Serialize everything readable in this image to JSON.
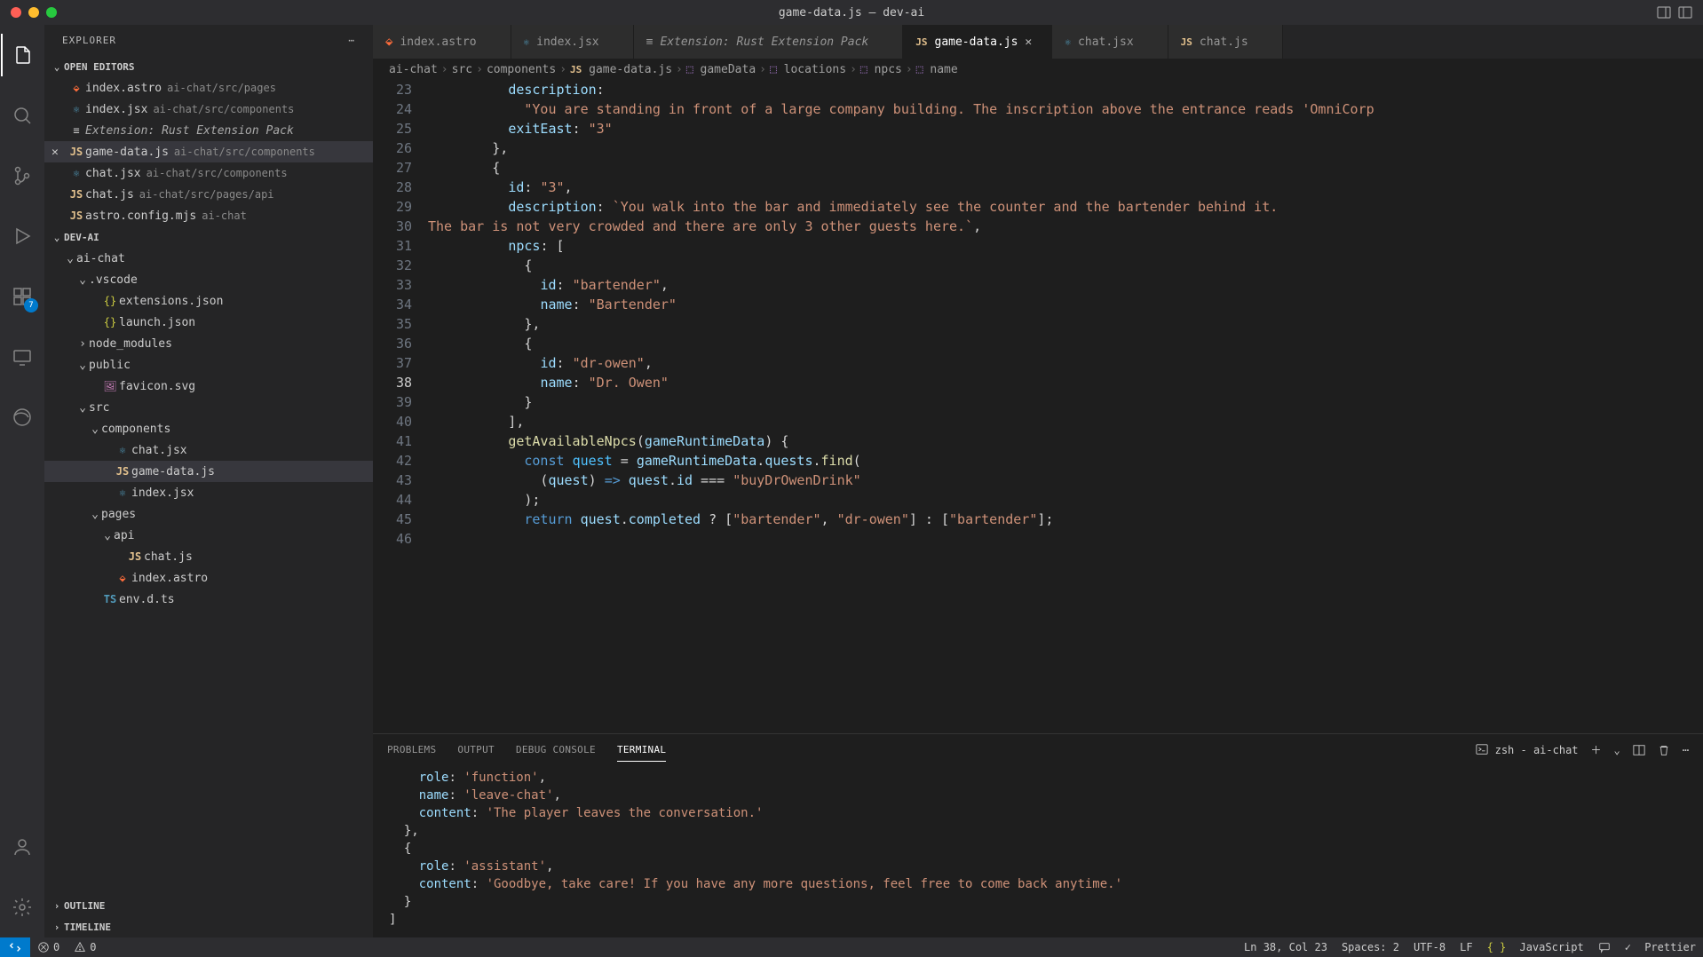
{
  "window": {
    "title": "game-data.js — dev-ai"
  },
  "sidebar": {
    "title": "EXPLORER",
    "openEditorsLabel": "OPEN EDITORS",
    "projectLabel": "DEV-AI",
    "outlineLabel": "OUTLINE",
    "timelineLabel": "TIMELINE",
    "openEditors": [
      {
        "name": "index.astro",
        "detail": "ai-chat/src/pages",
        "iconClass": "file-astro",
        "iconText": "⬙"
      },
      {
        "name": "index.jsx",
        "detail": "ai-chat/src/components",
        "iconClass": "file-jsx",
        "iconText": "⚛"
      },
      {
        "name": "Extension: Rust Extension Pack",
        "detail": "",
        "italic": true,
        "iconClass": "",
        "iconText": "≡"
      },
      {
        "name": "game-data.js",
        "detail": "ai-chat/src/components",
        "active": true,
        "iconClass": "file-js",
        "iconText": "JS"
      },
      {
        "name": "chat.jsx",
        "detail": "ai-chat/src/components",
        "iconClass": "file-jsx",
        "iconText": "⚛"
      },
      {
        "name": "chat.js",
        "detail": "ai-chat/src/pages/api",
        "iconClass": "file-js",
        "iconText": "JS"
      },
      {
        "name": "astro.config.mjs",
        "detail": "ai-chat",
        "iconClass": "file-js",
        "iconText": "JS"
      }
    ],
    "tree": [
      {
        "indent": 1,
        "name": "ai-chat",
        "folder": true,
        "open": true
      },
      {
        "indent": 2,
        "name": ".vscode",
        "folder": true,
        "open": true
      },
      {
        "indent": 3,
        "name": "extensions.json",
        "iconClass": "file-json",
        "iconText": "{}"
      },
      {
        "indent": 3,
        "name": "launch.json",
        "iconClass": "file-json",
        "iconText": "{}"
      },
      {
        "indent": 2,
        "name": "node_modules",
        "folder": true,
        "open": false
      },
      {
        "indent": 2,
        "name": "public",
        "folder": true,
        "open": true
      },
      {
        "indent": 3,
        "name": "favicon.svg",
        "iconClass": "file-svg",
        "iconText": "🖼"
      },
      {
        "indent": 2,
        "name": "src",
        "folder": true,
        "open": true
      },
      {
        "indent": 3,
        "name": "components",
        "folder": true,
        "open": true
      },
      {
        "indent": 4,
        "name": "chat.jsx",
        "iconClass": "file-jsx",
        "iconText": "⚛"
      },
      {
        "indent": 4,
        "name": "game-data.js",
        "iconClass": "file-js",
        "iconText": "JS",
        "active": true
      },
      {
        "indent": 4,
        "name": "index.jsx",
        "iconClass": "file-jsx",
        "iconText": "⚛"
      },
      {
        "indent": 3,
        "name": "pages",
        "folder": true,
        "open": true
      },
      {
        "indent": 4,
        "name": "api",
        "folder": true,
        "open": true
      },
      {
        "indent": 5,
        "name": "chat.js",
        "iconClass": "file-js",
        "iconText": "JS"
      },
      {
        "indent": 4,
        "name": "index.astro",
        "iconClass": "file-astro",
        "iconText": "⬙"
      },
      {
        "indent": 3,
        "name": "env.d.ts",
        "iconClass": "file-ts",
        "iconText": "TS"
      }
    ]
  },
  "tabs": [
    {
      "label": "index.astro",
      "iconClass": "file-astro",
      "iconText": "⬙"
    },
    {
      "label": "index.jsx",
      "iconClass": "file-jsx",
      "iconText": "⚛"
    },
    {
      "label": "Extension: Rust Extension Pack",
      "italic": true,
      "iconText": "≡"
    },
    {
      "label": "game-data.js",
      "iconClass": "file-js",
      "iconText": "JS",
      "active": true
    },
    {
      "label": "chat.jsx",
      "iconClass": "file-jsx",
      "iconText": "⚛"
    },
    {
      "label": "chat.js",
      "iconClass": "file-js",
      "iconText": "JS"
    }
  ],
  "breadcrumbs": [
    "ai-chat",
    "src",
    "components",
    "game-data.js",
    "gameData",
    "locations",
    "npcs",
    "name"
  ],
  "editor": {
    "firstLine": 23,
    "activeLine": 38,
    "lines": [
      {
        "n": 23,
        "segs": [
          [
            "          ",
            ""
          ],
          [
            "description",
            1
          ],
          [
            ":",
            3
          ]
        ]
      },
      {
        "n": 24,
        "segs": [
          [
            "            ",
            ""
          ],
          [
            "\"You are standing in front of a large company building. The inscription above the entrance reads 'OmniCorp",
            2
          ]
        ]
      },
      {
        "n": 25,
        "segs": [
          [
            "          ",
            ""
          ],
          [
            "exitEast",
            1
          ],
          [
            ": ",
            3
          ],
          [
            "\"3\"",
            2
          ]
        ]
      },
      {
        "n": 26,
        "segs": [
          [
            "        },",
            3
          ]
        ]
      },
      {
        "n": 27,
        "segs": [
          [
            "        {",
            3
          ]
        ]
      },
      {
        "n": 28,
        "segs": [
          [
            "          ",
            ""
          ],
          [
            "id",
            1
          ],
          [
            ": ",
            3
          ],
          [
            "\"3\"",
            2
          ],
          [
            ",",
            3
          ]
        ]
      },
      {
        "n": 29,
        "segs": [
          [
            "          ",
            ""
          ],
          [
            "description",
            1
          ],
          [
            ": ",
            3
          ],
          [
            "`You walk into the bar and immediately see the counter and the bartender behind it.",
            6
          ]
        ]
      },
      {
        "n": 30,
        "segs": [
          [
            "The bar is not very crowded and there are only 3 other guests here.`",
            6
          ],
          [
            ",",
            3
          ]
        ]
      },
      {
        "n": 31,
        "segs": [
          [
            "          ",
            ""
          ],
          [
            "npcs",
            1
          ],
          [
            ": [",
            3
          ]
        ]
      },
      {
        "n": 32,
        "segs": [
          [
            "            {",
            3
          ]
        ]
      },
      {
        "n": 33,
        "segs": [
          [
            "              ",
            ""
          ],
          [
            "id",
            1
          ],
          [
            ": ",
            3
          ],
          [
            "\"bartender\"",
            2
          ],
          [
            ",",
            3
          ]
        ]
      },
      {
        "n": 34,
        "segs": [
          [
            "              ",
            ""
          ],
          [
            "name",
            1
          ],
          [
            ": ",
            3
          ],
          [
            "\"Bartender\"",
            2
          ]
        ]
      },
      {
        "n": 35,
        "segs": [
          [
            "            },",
            3
          ]
        ]
      },
      {
        "n": 36,
        "segs": [
          [
            "            {",
            3
          ]
        ]
      },
      {
        "n": 37,
        "segs": [
          [
            "              ",
            ""
          ],
          [
            "id",
            1
          ],
          [
            ": ",
            3
          ],
          [
            "\"dr-owen\"",
            2
          ],
          [
            ",",
            3
          ]
        ]
      },
      {
        "n": 38,
        "segs": [
          [
            "              ",
            ""
          ],
          [
            "name",
            1
          ],
          [
            ": ",
            3
          ],
          [
            "\"Dr. Owen\"",
            2
          ]
        ]
      },
      {
        "n": 39,
        "segs": [
          [
            "            }",
            3
          ]
        ]
      },
      {
        "n": 40,
        "segs": [
          [
            "          ],",
            3
          ]
        ]
      },
      {
        "n": 41,
        "segs": [
          [
            "          ",
            ""
          ],
          [
            "getAvailableNpcs",
            5
          ],
          [
            "(",
            3
          ],
          [
            "gameRuntimeData",
            4
          ],
          [
            ") {",
            3
          ]
        ]
      },
      {
        "n": 42,
        "segs": [
          [
            "            ",
            ""
          ],
          [
            "const",
            0
          ],
          [
            " ",
            3
          ],
          [
            "quest",
            7
          ],
          [
            " = ",
            3
          ],
          [
            "gameRuntimeData",
            4
          ],
          [
            ".",
            3
          ],
          [
            "quests",
            4
          ],
          [
            ".",
            3
          ],
          [
            "find",
            5
          ],
          [
            "(",
            3
          ]
        ]
      },
      {
        "n": 43,
        "segs": [
          [
            "              (",
            ""
          ],
          [
            "quest",
            4
          ],
          [
            ") ",
            3
          ],
          [
            "=>",
            0
          ],
          [
            " ",
            3
          ],
          [
            "quest",
            4
          ],
          [
            ".",
            3
          ],
          [
            "id",
            4
          ],
          [
            " === ",
            3
          ],
          [
            "\"buyDrOwenDrink\"",
            2
          ]
        ]
      },
      {
        "n": 44,
        "segs": [
          [
            "            );",
            3
          ]
        ]
      },
      {
        "n": 45,
        "segs": [
          [
            "",
            ""
          ]
        ]
      },
      {
        "n": 46,
        "segs": [
          [
            "            ",
            ""
          ],
          [
            "return",
            0
          ],
          [
            " ",
            3
          ],
          [
            "quest",
            4
          ],
          [
            ".",
            3
          ],
          [
            "completed",
            4
          ],
          [
            " ? [",
            3
          ],
          [
            "\"bartender\"",
            2
          ],
          [
            ", ",
            3
          ],
          [
            "\"dr-owen\"",
            2
          ],
          [
            "] : [",
            3
          ],
          [
            "\"bartender\"",
            2
          ],
          [
            "];",
            3
          ]
        ]
      }
    ],
    "tokenClasses": [
      "tok-kw",
      "tok-prop",
      "tok-str",
      "tok-punc",
      "tok-param",
      "tok-fn",
      "tok-tmpl",
      "tok-var"
    ]
  },
  "panel": {
    "tabs": [
      "PROBLEMS",
      "OUTPUT",
      "DEBUG CONSOLE",
      "TERMINAL"
    ],
    "activeTab": 3,
    "shell": "zsh - ai-chat",
    "terminalLines": [
      {
        "segs": [
          [
            "    role",
            1
          ],
          [
            ": ",
            3
          ],
          [
            "'function'",
            2
          ],
          [
            ",",
            3
          ]
        ]
      },
      {
        "segs": [
          [
            "    name",
            1
          ],
          [
            ": ",
            3
          ],
          [
            "'leave-chat'",
            2
          ],
          [
            ",",
            3
          ]
        ]
      },
      {
        "segs": [
          [
            "    content",
            1
          ],
          [
            ": ",
            3
          ],
          [
            "'The player leaves the conversation.'",
            2
          ]
        ]
      },
      {
        "segs": [
          [
            "  },",
            3
          ]
        ]
      },
      {
        "segs": [
          [
            "  {",
            3
          ]
        ]
      },
      {
        "segs": [
          [
            "    role",
            1
          ],
          [
            ": ",
            3
          ],
          [
            "'assistant'",
            2
          ],
          [
            ",",
            3
          ]
        ]
      },
      {
        "segs": [
          [
            "    content",
            1
          ],
          [
            ": ",
            3
          ],
          [
            "'Goodbye, take care! If you have any more questions, feel free to come back anytime.'",
            2
          ]
        ]
      },
      {
        "segs": [
          [
            "  }",
            3
          ]
        ]
      },
      {
        "segs": [
          [
            "]",
            3
          ]
        ]
      }
    ]
  },
  "status": {
    "errors": "0",
    "warnings": "0",
    "cursor": "Ln 38, Col 23",
    "spaces": "Spaces: 2",
    "encoding": "UTF-8",
    "eol": "LF",
    "language": "JavaScript",
    "prettier": "Prettier"
  },
  "activityBadge": "7"
}
